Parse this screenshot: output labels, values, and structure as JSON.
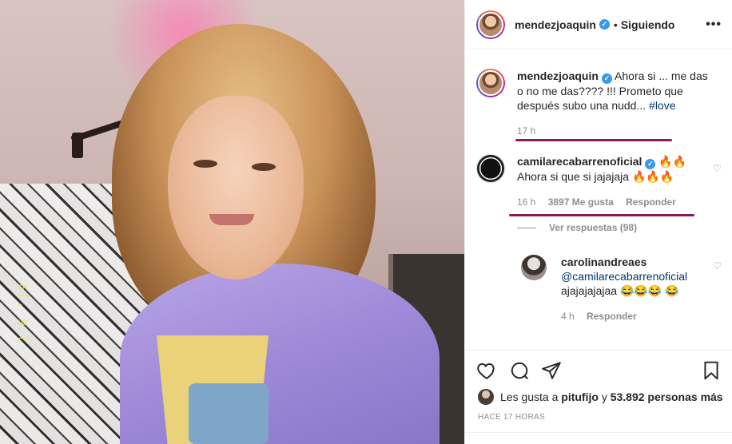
{
  "post": {
    "username": "mendezjoaquin",
    "following_label": "Siguiendo",
    "date_stamp": "2 6 '19"
  },
  "caption": {
    "username": "mendezjoaquin",
    "text": "Ahora si ... me das o no me das???? !!! Prometo que después subo una nudd... ",
    "hashtag": "#love",
    "time": "17 h"
  },
  "comment1": {
    "username": "camilarecabarrenoficial",
    "emoji_inline": "🔥🔥",
    "text": "Ahora si que si jajajaja 🔥🔥🔥",
    "time": "16 h",
    "likes": "3897 Me gusta",
    "reply": "Responder",
    "view_replies": "Ver respuestas (98)"
  },
  "comment2": {
    "username": "carolinandreaes",
    "mention": "@camilarecabarrenoficial",
    "text": "ajajajajajaa 😂😂😂 😂",
    "time": "4 h",
    "reply": "Responder"
  },
  "likes_line": {
    "prefix": "Les gusta a ",
    "user": "pitufijo",
    "middle": " y ",
    "count": "53.892 personas más"
  },
  "posted_ago": "HACE 17 HORAS",
  "colors": {
    "verified": "#3897f0",
    "annotation_underline": "#8a1b5b",
    "link": "#00376b"
  }
}
